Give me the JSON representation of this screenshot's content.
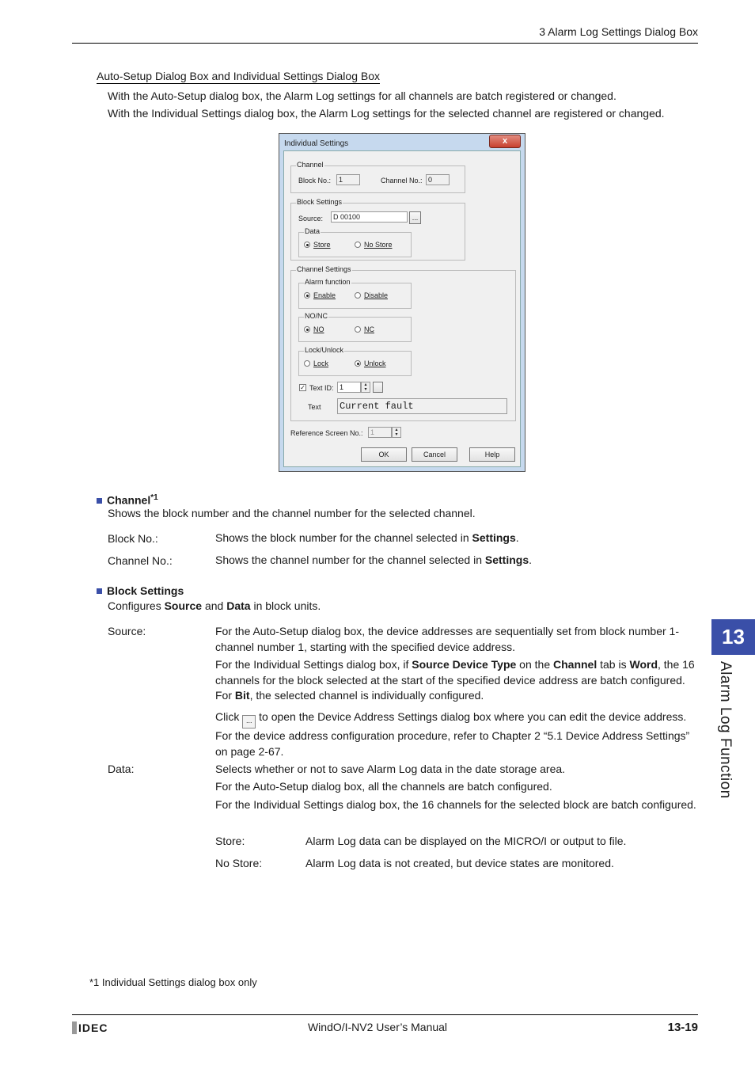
{
  "header": {
    "section_title": "3 Alarm Log Settings Dialog Box"
  },
  "section": {
    "title": "Auto-Setup Dialog Box and Individual Settings Dialog Box",
    "intro": [
      "With the Auto-Setup dialog box, the Alarm Log settings for all channels are batch registered or changed.",
      "With the Individual Settings dialog box, the Alarm Log settings for the selected channel are registered or changed."
    ]
  },
  "dialog": {
    "title": "Individual Settings",
    "close_label": "x",
    "channel_group": "Channel",
    "block_no_label": "Block No.:",
    "block_no_value": "1",
    "channel_no_label": "Channel No.:",
    "channel_no_value": "0",
    "block_settings_group": "Block Settings",
    "source_label": "Source:",
    "source_value": "D 00100",
    "browse_label": "...",
    "data_group": "Data",
    "data_store": "Store",
    "data_no_store": "No Store",
    "data_selected": "Store",
    "channel_settings_group": "Channel Settings",
    "alarm_group": "Alarm function",
    "alarm_enable": "Enable",
    "alarm_disable": "Disable",
    "alarm_selected": "Enable",
    "nonc_group": "NO/NC",
    "no_label": "NO",
    "nc_label": "NC",
    "nonc_selected": "NO",
    "lock_group": "Lock/Unlock",
    "lock_label": "Lock",
    "unlock_label": "Unlock",
    "lock_selected": "Unlock",
    "text_id_label": "Text ID:",
    "text_id_checked": true,
    "text_id_value": "1",
    "text_label": "Text",
    "text_value": "Current fault",
    "ref_screen_label": "Reference Screen No.:",
    "ref_screen_value": "1",
    "ok_label": "OK",
    "cancel_label": "Cancel",
    "help_label": "Help"
  },
  "channel_section": {
    "heading": "Channel",
    "footnote_ref": "*1",
    "desc": "Shows the block number and the channel number for the selected channel.",
    "items": [
      {
        "label": "Block No.:",
        "text": "Shows the block number for the channel selected in ",
        "bold": "Settings",
        "end": "."
      },
      {
        "label": "Channel No.:",
        "text": "Shows the channel number for the channel selected in ",
        "bold": "Settings",
        "end": "."
      }
    ]
  },
  "block_section": {
    "heading": "Block Settings",
    "desc_a": "Configures ",
    "desc_b1": "Source",
    "desc_c": " and ",
    "desc_b2": "Data",
    "desc_d": " in block units.",
    "source_label": "Source:",
    "source_p1": "For the Auto-Setup dialog box, the device addresses are sequentially set from block number 1-channel number 1, starting with the specified device address.",
    "source_p2": {
      "a": "For the Individual Settings dialog box, if ",
      "b1": "Source Device Type",
      "c": " on the ",
      "b2": "Channel",
      "d": " tab is ",
      "b3": "Word",
      "e": ", the 16 channels for the block selected at the start of the specified device address are batch configured. For ",
      "b4": "Bit",
      "f": ", the selected channel is individually configured."
    },
    "source_p3": {
      "a": "Click ",
      "btn": "...",
      "b": " to open the Device Address Settings dialog box where you can edit the device address. For the device address configuration procedure, refer to Chapter 2 “5.1 Device Address Settings” on page 2-67."
    },
    "data_label": "Data:",
    "data_p1": "Selects whether or not to save Alarm Log data in the date storage area.",
    "data_p2": "For the Auto-Setup dialog box, all the channels are batch configured.",
    "data_p3": "For the Individual Settings dialog box, the 16 channels for the selected block are batch configured.",
    "store_label": "Store:",
    "store_text": "Alarm Log data can be displayed on the MICRO/I or output to file.",
    "nostore_label": "No Store:",
    "nostore_text": "Alarm Log data is not created, but device states are monitored."
  },
  "side_tab": {
    "chapter": "13",
    "title": "Alarm Log Function"
  },
  "footnote": "*1  Individual Settings dialog box only",
  "footer": {
    "logo": "IDEC",
    "manual": "WindO/I-NV2 User’s Manual",
    "page": "13-19"
  },
  "colors": {
    "accent": "#3a4fa8"
  }
}
